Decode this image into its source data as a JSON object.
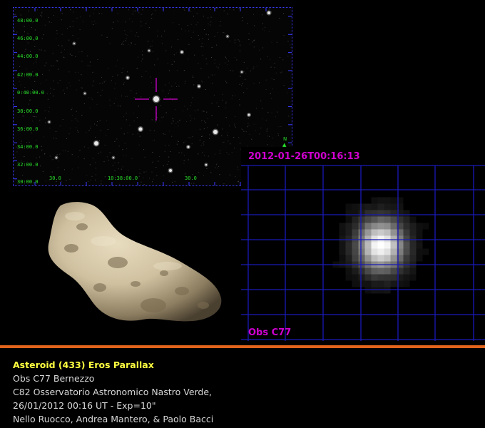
{
  "starfield": {
    "dec_labels": [
      "48:00.0",
      "46:00.0",
      "44:00.0",
      "42:00.0",
      "0:40:00.0",
      "38:00.0",
      "36:00.0",
      "34:00.0",
      "32:00.0",
      "30:00.0"
    ],
    "ra_labels": [
      "30.0",
      "10:38:00.0",
      "30.0"
    ],
    "north_label": "N",
    "grid_color": "#3a3aff",
    "label_color": "#29e02b",
    "marker_color": "#d000d0"
  },
  "zoom": {
    "timestamp": "2012-01-26T00:16:13",
    "observatory_label": "Obs C77",
    "grid_color": "#1a1ab8",
    "text_color": "#d000d0"
  },
  "asteroid_model": {
    "icon": "eros-3d-model",
    "color": "#cfc1a0"
  },
  "divider_color": "#e0641b",
  "caption": {
    "title": "Asteroid (433) Eros Parallax",
    "lines": [
      "Obs C77 Bernezzo",
      "C82 Osservatorio Astronomico Nastro Verde,",
      "26/01/2012  00:16 UT -  Exp=10\"",
      "Nello Ruocco, Andrea Mantero, & Paolo Bacci"
    ]
  }
}
